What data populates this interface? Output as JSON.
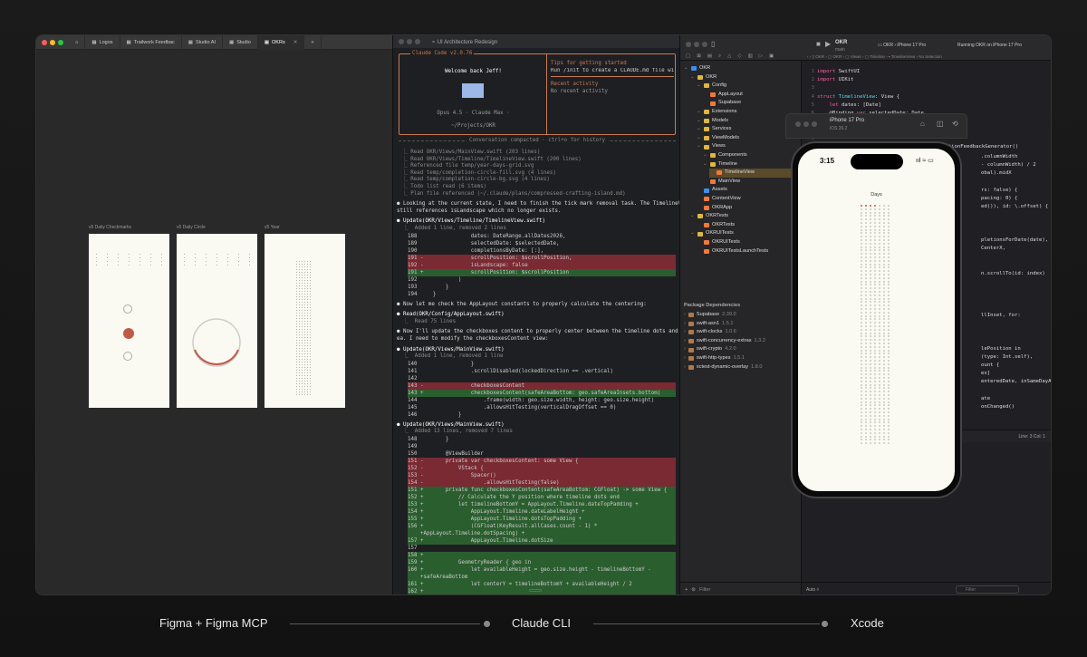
{
  "figma": {
    "tabs": [
      {
        "label": "Logos"
      },
      {
        "label": "Trailwork Feedbac"
      },
      {
        "label": "Studio AI"
      },
      {
        "label": "Studio"
      },
      {
        "label": "OKRs"
      }
    ],
    "frames": [
      {
        "label": "v5 Daily Checkmarks"
      },
      {
        "label": "v5 Daily Circle"
      },
      {
        "label": "v5 Year"
      }
    ]
  },
  "terminal": {
    "title": "UI Architecture Redesign",
    "version": "Claude Code v2.0.76",
    "welcome": "Welcome back Jeff!",
    "model": "Opus 4.5 · Claude Max ·",
    "path": "~/Projects/OKR",
    "tips_title": "Tips for getting started",
    "tips_text": "Run /init to create a CLAUDE.md file with i…",
    "recent_title": "Recent activity",
    "recent_text": "No recent activity",
    "compacted": "Conversation compacted · ctrl+o for history",
    "log": [
      "⎿ Read OKR/Views/MainView.swift (203 lines)",
      "⎿ Read OKR/Views/Timeline/TimelineView.swift (200 lines)",
      "⎿ Referenced file temp/year-days-grid.svg",
      "⎿ Read temp/completion-circle-fill.svg (4 lines)",
      "⎿ Read temp/completion-circle-bg.svg (4 lines)",
      "⎿ Todo list read (6 items)",
      "⎿ Plan file referenced (~/.claude/plans/compressed-crafting-island.md)"
    ],
    "msg1a": "● Looking at the current state, I need to finish the tick mark removal task. The TimelineView preview",
    "msg1b": "still references isLandscape which no longer exists.",
    "upd1": "● Update(OKR/Views/Timeline/TimelineView.swift)",
    "upd1s": "  ⎿  Added 1 line, removed 2 lines",
    "diff1": [
      {
        "t": "n",
        "s": "188                 dates: DateRange.allDates2026,"
      },
      {
        "t": "n",
        "s": "189                 selectedDate: $selectedDate,"
      },
      {
        "t": "n",
        "s": "190                 completionsByDate: [:],"
      },
      {
        "t": "d",
        "s": "191 -               scrollPosition: $scrollPosition,"
      },
      {
        "t": "d",
        "s": "192 -               isLandscape: false"
      },
      {
        "t": "a",
        "s": "191 +               scrollPosition: $scrollPosition"
      },
      {
        "t": "n",
        "s": "192             )"
      },
      {
        "t": "n",
        "s": "193         }"
      },
      {
        "t": "n",
        "s": "194     }"
      }
    ],
    "msg2": "● Now let me check the AppLayout constants to properly calculate the centering:",
    "read2": "● Read(OKR/Config/AppLayout.swift)",
    "read2s": "  ⎿  Read 75 lines",
    "msg3a": "● Now I'll update the checkboxes content to properly center between the timeline dots and the safe ar",
    "msg3b": "ea. I need to modify the checkboxesContent view:",
    "upd2": "● Update(OKR/Views/MainView.swift)",
    "upd2s": "  ⎿  Added 1 line, removed 1 line",
    "diff2": [
      {
        "t": "n",
        "s": "140                 }"
      },
      {
        "t": "n",
        "s": "141                 .scrollDisabled(lockedDirection == .vertical)"
      },
      {
        "t": "n",
        "s": "142"
      },
      {
        "t": "d",
        "s": "143 -               checkboxesContent"
      },
      {
        "t": "a",
        "s": "143 +               checkboxesContent(safeAreaBottom: geo.safeAreaInsets.bottom)"
      },
      {
        "t": "n",
        "s": "144                     .frame(width: geo.size.width, height: geo.size.height)"
      },
      {
        "t": "n",
        "s": "145                     .allowsHitTesting(verticalDragOffset == 0)"
      },
      {
        "t": "n",
        "s": "146             }"
      }
    ],
    "upd3": "● Update(OKR/Views/MainView.swift)",
    "upd3s": "  ⎿  Added 13 lines, removed 7 lines",
    "diff3": [
      {
        "t": "n",
        "s": "148         }"
      },
      {
        "t": "n",
        "s": "149"
      },
      {
        "t": "n",
        "s": "150         @ViewBuilder"
      },
      {
        "t": "d",
        "s": "151 -       private var checkboxesContent: some View {"
      },
      {
        "t": "d",
        "s": "152 -           VStack {"
      },
      {
        "t": "d",
        "s": "153 -               Spacer()"
      },
      {
        "t": "d",
        "s": "154 -                   .allowsHitTesting(false)"
      },
      {
        "t": "a",
        "s": "151 +       private func checkboxesContent(safeAreaBottom: CGFloat) -> some View {"
      },
      {
        "t": "a",
        "s": "152 +           // Calculate the Y position where timeline dots end"
      },
      {
        "t": "a",
        "s": "153 +           let timelineBottomY = AppLayout.Timeline.dateTopPadding +"
      },
      {
        "t": "a",
        "s": "154 +               AppLayout.Timeline.dateLabelHeight +"
      },
      {
        "t": "a",
        "s": "155 +               AppLayout.Timeline.dotsTopPadding +"
      },
      {
        "t": "a",
        "s": "156 +               (CGFloat(KeyResult.allCases.count - 1) *"
      },
      {
        "t": "a",
        "s": "    +AppLayout.Timeline.dotSpacing) +"
      },
      {
        "t": "a",
        "s": "157 +               AppLayout.Timeline.dotSize"
      },
      {
        "t": "n",
        "s": "157"
      },
      {
        "t": "a",
        "s": "158 +"
      },
      {
        "t": "a",
        "s": "159 +           GeometryReader { geo in"
      },
      {
        "t": "a",
        "s": "160 +               let availableHeight = geo.size.height - timelineBottomY -"
      },
      {
        "t": "a",
        "s": "    +safeAreaBottom"
      },
      {
        "t": "a",
        "s": "161 +               let centerY = timelineBottomY + availableHeight / 2"
      },
      {
        "t": "a",
        "s": "162 +"
      },
      {
        "t": "n",
        "s": "163               Group {"
      }
    ]
  },
  "xcode": {
    "project": "OKR",
    "branch": "main",
    "device": "iPhone 17 Pro",
    "status": "Running OKR on iPhone 17 Pro",
    "nosel": "No Selection",
    "nav": [
      {
        "d": 0,
        "label": "OKR",
        "c": "#3c8ff0"
      },
      {
        "d": 1,
        "label": "OKR",
        "c": "#e0b640"
      },
      {
        "d": 2,
        "label": "Config",
        "c": "#e0b640"
      },
      {
        "d": 3,
        "label": "AppLayout",
        "c": "#f07a3c"
      },
      {
        "d": 3,
        "label": "Supabase",
        "c": "#f07a3c"
      },
      {
        "d": 2,
        "label": "Extensions",
        "c": "#e0b640"
      },
      {
        "d": 2,
        "label": "Models",
        "c": "#e0b640"
      },
      {
        "d": 2,
        "label": "Services",
        "c": "#e0b640"
      },
      {
        "d": 2,
        "label": "ViewModels",
        "c": "#e0b640"
      },
      {
        "d": 2,
        "label": "Views",
        "c": "#e0b640"
      },
      {
        "d": 3,
        "label": "Components",
        "c": "#e0b640"
      },
      {
        "d": 3,
        "label": "Timeline",
        "c": "#e0b640"
      },
      {
        "d": 4,
        "label": "TimelineView",
        "c": "#f07a3c",
        "sel": true
      },
      {
        "d": 3,
        "label": "MainView",
        "c": "#f07a3c"
      },
      {
        "d": 2,
        "label": "Assets",
        "c": "#3c8ff0"
      },
      {
        "d": 2,
        "label": "ContentView",
        "c": "#f07a3c"
      },
      {
        "d": 2,
        "label": "OKRApp",
        "c": "#f07a3c"
      },
      {
        "d": 1,
        "label": "OKRTests",
        "c": "#e0b640"
      },
      {
        "d": 2,
        "label": "OKRTests",
        "c": "#f07a3c"
      },
      {
        "d": 1,
        "label": "OKRUITests",
        "c": "#e0b640"
      },
      {
        "d": 2,
        "label": "OKRUITests",
        "c": "#f07a3c"
      },
      {
        "d": 2,
        "label": "OKRUITestsLaunchTests",
        "c": "#f07a3c"
      }
    ],
    "deps_title": "Package Dependencies",
    "deps": [
      {
        "name": "Supabase",
        "ver": "2.39.0"
      },
      {
        "name": "swift-asn1",
        "ver": "1.5.1"
      },
      {
        "name": "swift-clocks",
        "ver": "1.0.6"
      },
      {
        "name": "swift-concurrency-extras",
        "ver": "1.3.2"
      },
      {
        "name": "swift-crypto",
        "ver": "4.2.0"
      },
      {
        "name": "swift-http-types",
        "ver": "1.5.1"
      },
      {
        "name": "xctest-dynamic-overlay",
        "ver": "1.8.0"
      }
    ],
    "filter": "Filter",
    "lincol": "Line: 3  Col: 1",
    "auto": "Auto ◊",
    "code": [
      {
        "n": "1",
        "parts": [
          [
            "kw",
            "import "
          ],
          [
            "pl",
            "SwiftUI"
          ]
        ]
      },
      {
        "n": "2",
        "parts": [
          [
            "kw",
            "import "
          ],
          [
            "pl",
            "UIKit"
          ]
        ]
      },
      {
        "n": "3",
        "parts": [
          [
            "pl",
            ""
          ]
        ]
      },
      {
        "n": "4",
        "parts": [
          [
            "kw",
            "struct "
          ],
          [
            "ty",
            "TimelineView"
          ],
          [
            "pl",
            ": View {"
          ]
        ]
      },
      {
        "n": "5",
        "parts": [
          [
            "kw",
            "    let "
          ],
          [
            "pl",
            "dates: [Date]"
          ]
        ]
      },
      {
        "n": "6",
        "parts": [
          [
            "pl",
            "    @Binding "
          ],
          [
            "kw",
            "var "
          ],
          [
            "pl",
            "selectedDate: Date"
          ]
        ]
      },
      {
        "n": "7",
        "parts": [
          [
            "pl",
            "                                ]]"
          ]
        ]
      },
      {
        "n": "8",
        "parts": [
          [
            "pl",
            ""
          ]
        ]
      },
      {
        "n": "9",
        "parts": [
          [
            "pl",
            ""
          ]
        ]
      },
      {
        "n": "10",
        "parts": [
          [
            "pl",
            "    private let selectionFeedback = UISelectionFeedbackGenerator()"
          ]
        ]
      }
    ],
    "code2": [
      [
        "pl",
        ".columnWidth"
      ],
      [
        "pl",
        "- columnWidth) / 2"
      ],
      [
        "pl",
        "obal).midX"
      ],
      [
        "pl",
        ""
      ],
      [
        "pl",
        "rs: false) {"
      ],
      [
        "pl",
        "pacing: 0) {"
      ],
      [
        "pl",
        "ed()), id: \\.offset) {"
      ],
      [
        "pl",
        ""
      ],
      [
        "pl",
        ""
      ],
      [
        "pl",
        ""
      ],
      [
        "pl",
        "pletionsForDate(date),"
      ],
      [
        "pl",
        "CenterX,"
      ],
      [
        "pl",
        ""
      ],
      [
        "pl",
        ""
      ],
      [
        "pl",
        "n.scrollTo(id: index)"
      ],
      [
        "pl",
        ""
      ],
      [
        "pl",
        ""
      ],
      [
        "pl",
        ""
      ],
      [
        "pl",
        ""
      ],
      [
        "pl",
        "llInset, for:"
      ],
      [
        "pl",
        ""
      ],
      [
        "pl",
        ""
      ],
      [
        "pl",
        ""
      ],
      [
        "pl",
        "lePosition in"
      ],
      [
        "pl",
        "(type: Int.self),"
      ],
      [
        "pl",
        "ount {"
      ],
      [
        "pl",
        "ex]"
      ],
      [
        "pl",
        "enteredDate, inSameDayAs:"
      ],
      [
        "pl",
        ""
      ],
      [
        "pl",
        "ate"
      ],
      [
        "pl",
        "onChanged()"
      ]
    ]
  },
  "simulator": {
    "title": "iPhone 17 Pro",
    "os": "iOS 26.2",
    "time": "3:15",
    "heading": "Days"
  },
  "captions": [
    {
      "label": "Figma + Figma MCP"
    },
    {
      "label": "Claude CLI"
    },
    {
      "label": "Xcode"
    }
  ]
}
